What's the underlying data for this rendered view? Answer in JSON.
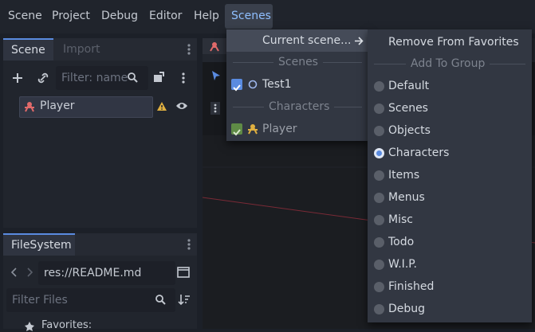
{
  "menubar": {
    "items": [
      "Scene",
      "Project",
      "Debug",
      "Editor",
      "Help"
    ],
    "active": "Scenes"
  },
  "scene_dock": {
    "tabs": [
      "Scene",
      "Import"
    ],
    "filter_placeholder": "Filter: name",
    "node": "Player"
  },
  "filesystem_dock": {
    "tab": "FileSystem",
    "path": "res://README.md",
    "filter_placeholder": "Filter Files",
    "favorites": "Favorites:"
  },
  "scenes_menu": {
    "current_scene": "Current scene...",
    "sections": [
      {
        "label": "Scenes",
        "items": [
          {
            "label": "Test1",
            "checked": true
          }
        ]
      },
      {
        "label": "Characters",
        "items": [
          {
            "label": "Player",
            "checked": true
          }
        ]
      }
    ]
  },
  "submenu": {
    "remove": "Remove From Favorites",
    "add_group": "Add To Group",
    "groups": [
      "Default",
      "Scenes",
      "Objects",
      "Characters",
      "Items",
      "Menus",
      "Misc",
      "Todo",
      "W.I.P.",
      "Finished",
      "Debug"
    ],
    "selected": "Characters"
  },
  "colors": {
    "accent": "#5a8be0",
    "warning": "#e0b040",
    "node_icon": "#e06a6a",
    "character_check": "#6aa84f"
  }
}
